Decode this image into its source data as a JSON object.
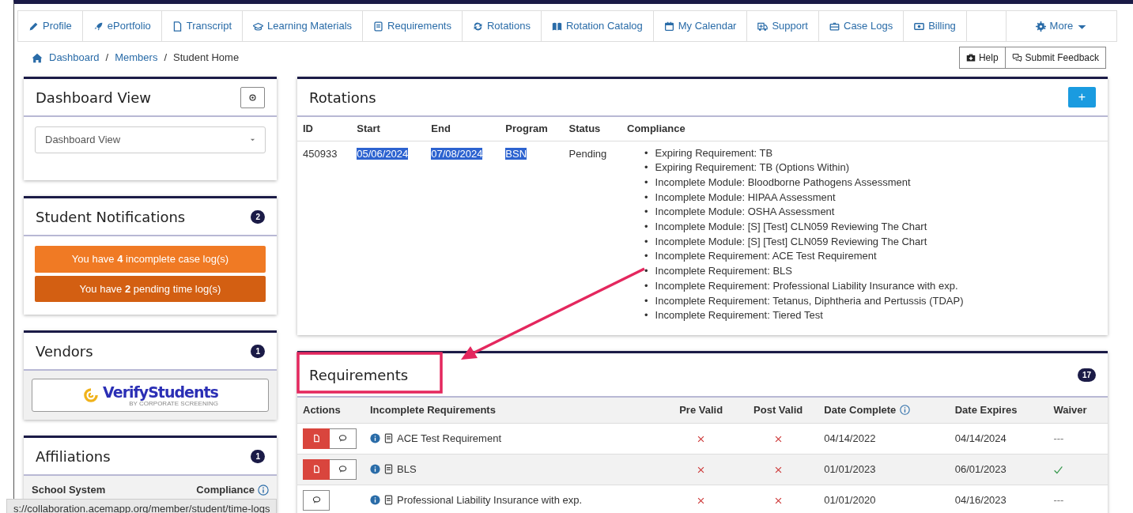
{
  "nav": {
    "items": [
      {
        "label": "Profile"
      },
      {
        "label": "ePortfolio"
      },
      {
        "label": "Transcript"
      },
      {
        "label": "Learning Materials"
      },
      {
        "label": "Requirements"
      },
      {
        "label": "Rotations"
      },
      {
        "label": "Rotation Catalog"
      },
      {
        "label": "My Calendar"
      },
      {
        "label": "Support"
      },
      {
        "label": "Case Logs"
      },
      {
        "label": "Billing"
      }
    ],
    "more": {
      "label": "More"
    }
  },
  "breadcrumb": [
    {
      "label": "Dashboard",
      "current": false
    },
    {
      "separator": "/",
      "label": "Members",
      "current": false
    },
    {
      "separator": "/",
      "label": "Student Home",
      "current": true
    }
  ],
  "header_buttons": [
    {
      "label": "Help"
    },
    {
      "label": "Submit Feedback"
    }
  ],
  "dashboard_view": {
    "title": "Dashboard View",
    "select_value": "Dashboard View"
  },
  "notifications": {
    "title": "Student Notifications",
    "count": "2",
    "items": [
      {
        "text": "You have **4** incomplete case log(s)",
        "color": "#f07a24"
      },
      {
        "text": "You have **2** pending time log(s)",
        "color": "#d35f12"
      }
    ]
  },
  "vendors": {
    "title": "Vendors",
    "count": "1",
    "logo_text": "VerifyStudents",
    "logo_subtext": "BY CORPORATE SCREENING"
  },
  "affiliations": {
    "title": "Affiliations",
    "count": "1",
    "columns": [
      "School System",
      "Compliance"
    ]
  },
  "rotations": {
    "title": "Rotations",
    "add_label": "+",
    "columns": [
      "ID",
      "Start",
      "End",
      "Program",
      "Status",
      "Compliance"
    ],
    "rows": [
      {
        "cells": [
          {
            "text": "450933",
            "highlighted": false
          },
          {
            "text": "05/06/2024",
            "highlighted": true
          },
          {
            "text": "07/08/2024",
            "highlighted": true
          },
          {
            "text": "BSN",
            "highlighted": true
          },
          {
            "text": "Pending",
            "highlighted": false
          }
        ],
        "compliance": [
          {
            "bullet": "•",
            "text": "Expiring Requirement: TB"
          },
          {
            "bullet": "•",
            "text": "Expiring Requirement: TB (Options Within)"
          },
          {
            "bullet": "•",
            "text": "Incomplete Module: Bloodborne Pathogens Assessment"
          },
          {
            "bullet": "•",
            "text": "Incomplete Module: HIPAA Assessment"
          },
          {
            "bullet": "•",
            "text": "Incomplete Module: OSHA Assessment"
          },
          {
            "bullet": "•",
            "text": "Incomplete Module: [S] [Test] CLN059 Reviewing The Chart"
          },
          {
            "bullet": "•",
            "text": "Incomplete Module: [S] [Test] CLN059 Reviewing The Chart"
          },
          {
            "bullet": "•",
            "text": "Incomplete Requirement: ACE Test Requirement"
          },
          {
            "bullet": "•",
            "text": "Incomplete Requirement: BLS"
          },
          {
            "bullet": "•",
            "text": "Incomplete Requirement: Professional Liability Insurance with exp."
          },
          {
            "bullet": "•",
            "text": "Incomplete Requirement: Tetanus, Diphtheria and Pertussis (TDAP)"
          },
          {
            "bullet": "•",
            "text": "Incomplete Requirement: Tiered Test"
          }
        ]
      }
    ]
  },
  "requirements": {
    "title": "Requirements",
    "count": "17",
    "columns": [
      "Actions",
      "Incomplete Requirements",
      "Pre Valid",
      "Post Valid",
      "Date Complete",
      "Date Expires",
      "Waiver"
    ],
    "rows": [
      {
        "has_document": true,
        "name": "ACE Test Requirement",
        "pre_valid": false,
        "post_valid": false,
        "date_complete": "04/14/2022",
        "date_expires": "04/14/2024",
        "waived": false,
        "waiver": "---"
      },
      {
        "has_document": true,
        "name": "BLS",
        "pre_valid": false,
        "post_valid": false,
        "date_complete": "01/01/2023",
        "date_expires": "06/01/2023",
        "waived": true
      },
      {
        "has_document": false,
        "name": "Professional Liability Insurance with exp.",
        "pre_valid": false,
        "post_valid": false,
        "date_complete": "01/01/2020",
        "date_expires": "04/16/2023",
        "waived": false,
        "waiver": "---"
      }
    ]
  },
  "status_bar": {
    "url": "s://collaboration.acemapp.org/member/student/time-logs"
  }
}
